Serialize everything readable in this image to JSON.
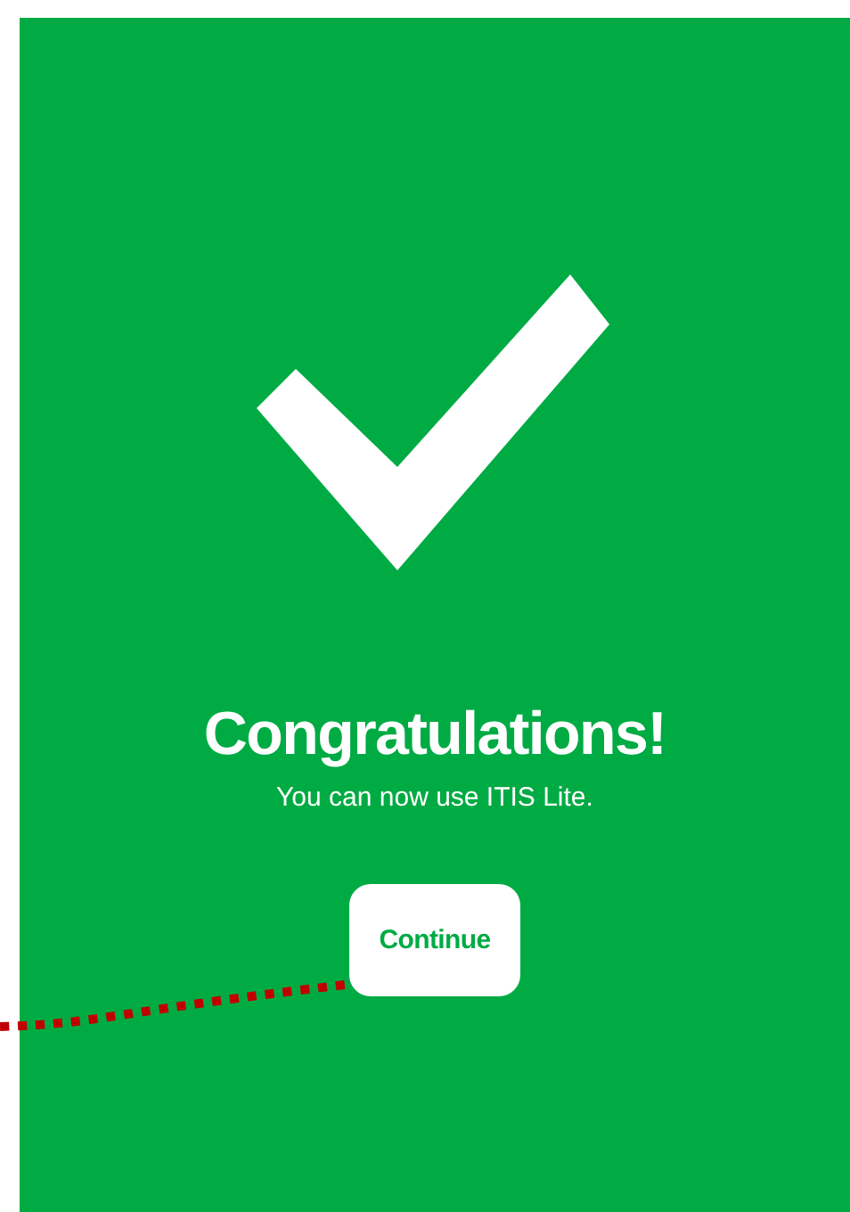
{
  "title": "Congratulations!",
  "message": "You can now use ITIS Lite.",
  "button": {
    "label": "Continue"
  }
}
